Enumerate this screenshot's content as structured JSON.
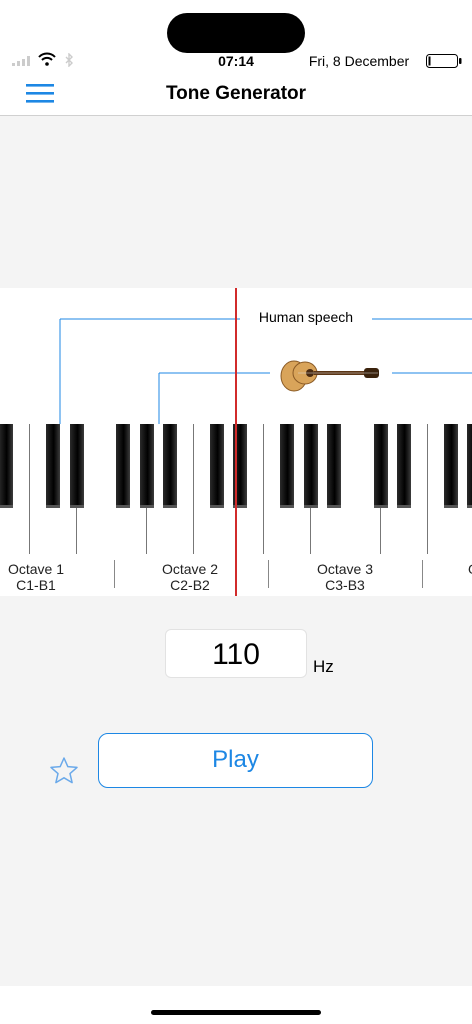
{
  "status_bar": {
    "time": "07:14",
    "date": "Fri, 8 December",
    "icons": [
      "signal-icon",
      "wifi-icon",
      "bluetooth-icon",
      "battery-icon"
    ]
  },
  "nav": {
    "title": "Tone Generator",
    "menu_icon": "hamburger-menu-icon"
  },
  "keyboard": {
    "range_labels": {
      "speech": "Human speech",
      "instrument_icon": "guitar-icon"
    },
    "octaves": [
      {
        "name": "Octave 1",
        "range": "C1-B1"
      },
      {
        "name": "Octave 2",
        "range": "C2-B2"
      },
      {
        "name": "Octave 3",
        "range": "C3-B3"
      },
      {
        "name": "O",
        "range": ""
      }
    ]
  },
  "frequency": {
    "value": "110",
    "unit": "Hz"
  },
  "controls": {
    "play_label": "Play",
    "favorite_icon": "star-icon"
  },
  "colors": {
    "accent": "#1d87e4",
    "playhead": "#d12b2b",
    "background": "#f4f4f4"
  }
}
